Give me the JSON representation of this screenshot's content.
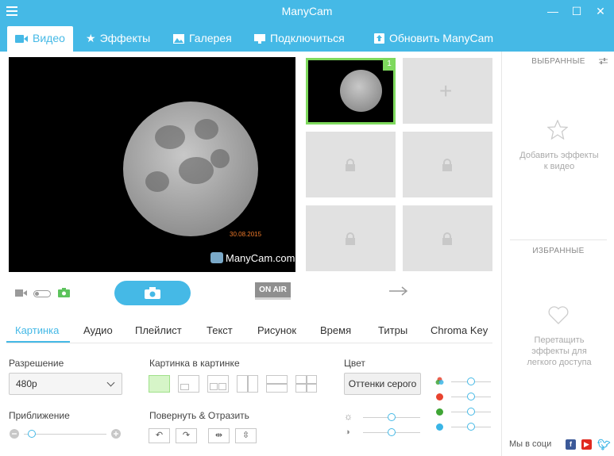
{
  "app": {
    "title": "ManyCam"
  },
  "tabs": [
    {
      "label": "Видео",
      "icon": "video-camera-icon"
    },
    {
      "label": "Эффекты",
      "icon": "star-icon"
    },
    {
      "label": "Галерея",
      "icon": "image-icon"
    },
    {
      "label": "Подключиться",
      "icon": "monitor-icon"
    },
    {
      "label": "Обновить ManyCam",
      "icon": "upload-icon"
    }
  ],
  "video": {
    "date_stamp": "30.08.2015",
    "watermark": "ManyCam.com"
  },
  "scenes": {
    "active_badge": "1",
    "add_symbol": "+"
  },
  "controls": {
    "on_air": "ON AIR"
  },
  "subtabs": [
    "Картинка",
    "Аудио",
    "Плейлист",
    "Текст",
    "Рисунок",
    "Время",
    "Титры",
    "Chroma Key"
  ],
  "settings": {
    "resolution_label": "Разрешение",
    "resolution_value": "480p",
    "zoom_label": "Приближение",
    "zoom_level": 0.05,
    "pip_label": "Картинка в картинке",
    "rotate_label": "Повернуть & Отразить",
    "color_label": "Цвет",
    "color_button": "Оттенки серого",
    "brightness_level": 0.5,
    "contrast_level": 0.5,
    "rgb_level": 0.5,
    "channel_colors": {
      "red": "#e8432f",
      "green": "#3fa535",
      "blue": "#3ab5e6"
    }
  },
  "right_panel": {
    "selected_header": "ВЫБРАННЫЕ",
    "selected_hint": "Добавить эффекты к видео",
    "favorites_header": "ИЗБРАННЫЕ",
    "favorites_hint": "Перетащить эффекты для легкого доступа",
    "social_label": "Мы в соци"
  },
  "colors": {
    "accent": "#45b9e6",
    "active_green": "#7ed95d"
  }
}
